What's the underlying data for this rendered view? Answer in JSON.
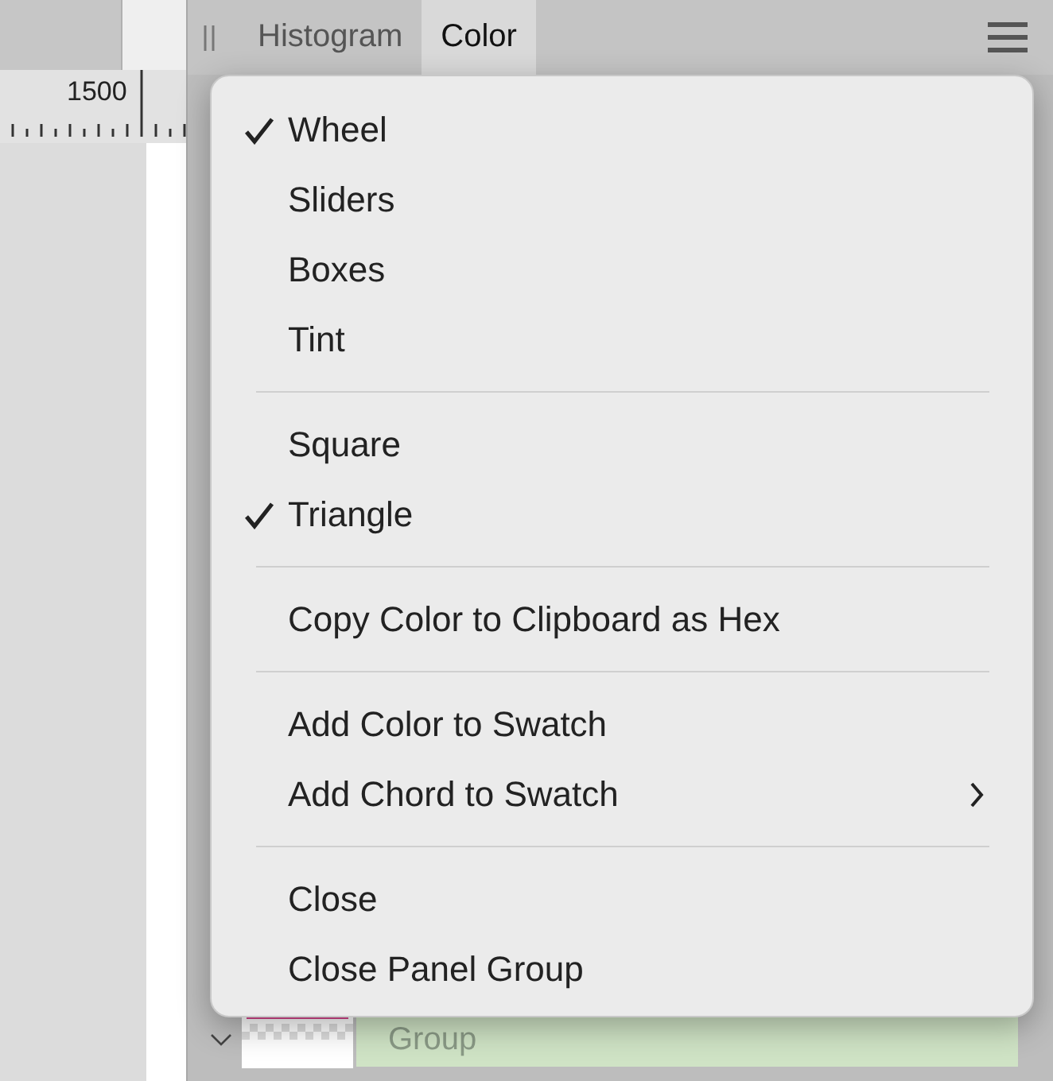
{
  "ruler": {
    "label": "1500"
  },
  "panel": {
    "tabs": [
      {
        "label": "Histogram",
        "selected": false
      },
      {
        "label": "Color",
        "selected": true
      }
    ]
  },
  "layers": [
    {
      "name": "Group",
      "expanded": true
    }
  ],
  "menu": {
    "sections": [
      [
        {
          "label": "Wheel",
          "checked": true,
          "submenu": false
        },
        {
          "label": "Sliders",
          "checked": false,
          "submenu": false
        },
        {
          "label": "Boxes",
          "checked": false,
          "submenu": false
        },
        {
          "label": "Tint",
          "checked": false,
          "submenu": false
        }
      ],
      [
        {
          "label": "Square",
          "checked": false,
          "submenu": false
        },
        {
          "label": "Triangle",
          "checked": true,
          "submenu": false
        }
      ],
      [
        {
          "label": "Copy Color to Clipboard as Hex",
          "checked": false,
          "submenu": false
        }
      ],
      [
        {
          "label": "Add Color to Swatch",
          "checked": false,
          "submenu": false
        },
        {
          "label": "Add Chord to Swatch",
          "checked": false,
          "submenu": true
        }
      ],
      [
        {
          "label": "Close",
          "checked": false,
          "submenu": false
        },
        {
          "label": "Close Panel Group",
          "checked": false,
          "submenu": false
        }
      ]
    ]
  }
}
